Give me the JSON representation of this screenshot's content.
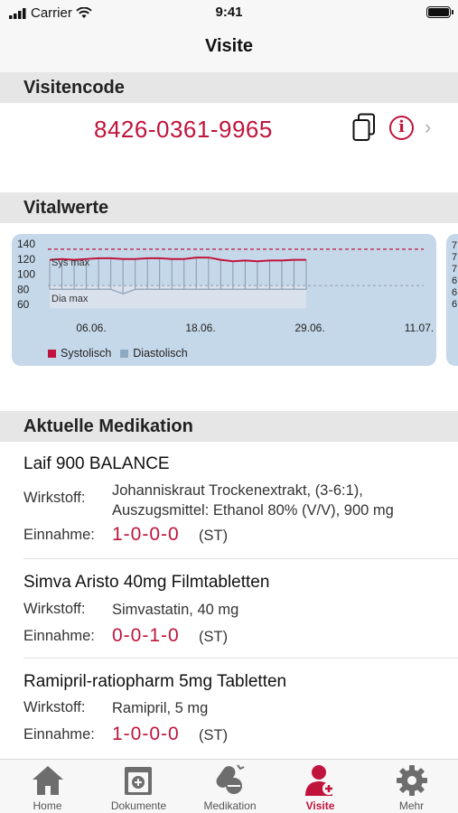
{
  "status": {
    "carrier": "Carrier",
    "time": "9:41"
  },
  "nav": {
    "title": "Visite"
  },
  "visitencode": {
    "header": "Visitencode",
    "code": "8426-0361-9965"
  },
  "vitalwerte": {
    "header": "Vitalwerte",
    "y_ticks": [
      "140",
      "120",
      "100",
      "80",
      "60"
    ],
    "x_ticks": [
      "06.06.",
      "18.06.",
      "29.06.",
      "11.07."
    ],
    "sys_max_label": "Sys max",
    "dia_max_label": "Dia max",
    "legend": [
      {
        "label": "Systolisch",
        "color": "#c0143c"
      },
      {
        "label": "Diastolisch",
        "color": "#8fa9c2"
      }
    ],
    "next_card_ticks": [
      "7",
      "7",
      "7",
      "6",
      "6",
      "6"
    ]
  },
  "chart_data": {
    "type": "line",
    "ylim": [
      60,
      140
    ],
    "x_tick_labels": [
      "06.06.",
      "18.06.",
      "29.06.",
      "11.07."
    ],
    "sys_max": 133,
    "dia_max": 85,
    "series": [
      {
        "name": "Systolisch",
        "values": [
          119,
          120,
          119,
          120,
          121,
          121,
          120,
          120,
          121,
          121,
          120,
          120,
          122,
          122,
          119,
          117,
          118,
          117,
          118,
          118,
          119,
          119
        ]
      },
      {
        "name": "Diastolisch",
        "values": [
          80,
          80,
          80,
          80,
          80,
          80,
          74,
          80,
          80,
          80,
          80,
          80,
          80,
          80,
          80,
          80,
          80,
          80,
          80,
          80,
          80,
          80
        ]
      }
    ]
  },
  "medikation": {
    "header": "Aktuelle Medikation",
    "wirkstoff_label": "Wirkstoff:",
    "einnahme_label": "Einnahme:",
    "items": [
      {
        "name": "Laif 900 BALANCE",
        "wirkstoff": "Johanniskraut Trockenextrakt, (3-6:1), Auszugsmittel: Ethanol 80% (V/V), 900 mg",
        "dose": "1-0-0-0",
        "unit": "(ST)"
      },
      {
        "name": "Simva Aristo 40mg Filmtabletten",
        "wirkstoff": "Simvastatin, 40 mg",
        "dose": "0-0-1-0",
        "unit": "(ST)"
      },
      {
        "name": "Ramipril-ratiopharm 5mg Tabletten",
        "wirkstoff": "Ramipril, 5 mg",
        "dose": "1-0-0-0",
        "unit": "(ST)"
      }
    ]
  },
  "tabs": [
    {
      "label": "Home",
      "icon": "house-icon",
      "active": false
    },
    {
      "label": "Dokumente",
      "icon": "document-icon",
      "active": false
    },
    {
      "label": "Medikation",
      "icon": "pills-icon",
      "active": false
    },
    {
      "label": "Visite",
      "icon": "doctor-icon",
      "active": true
    },
    {
      "label": "Mehr",
      "icon": "gear-icon",
      "active": false
    }
  ],
  "colors": {
    "accent": "#c0143c",
    "chart_bg": "#c5d8ea"
  }
}
